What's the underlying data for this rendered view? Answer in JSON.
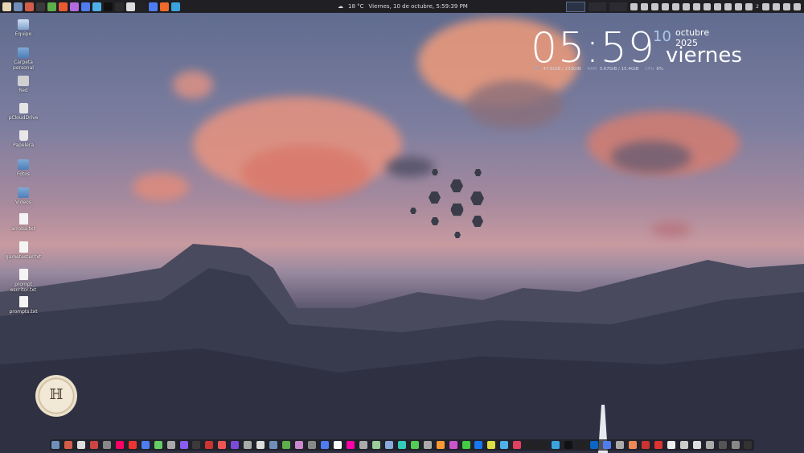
{
  "topbar": {
    "weather_icon": "cloud-rain-icon",
    "temperature": "18 °C",
    "datetime": "Viernes, 10 de octubre, 5:59:39 PM",
    "app_icons": [
      {
        "name": "avatar",
        "color": "#e8d5b5"
      },
      {
        "name": "files",
        "color": "#6f8fb8"
      },
      {
        "name": "screenshot",
        "color": "#d35d4a"
      },
      {
        "name": "terminal",
        "color": "#3a3a3a"
      },
      {
        "name": "plant",
        "color": "#5fae4d"
      },
      {
        "name": "tool",
        "color": "#e85a33"
      },
      {
        "name": "colors",
        "color": "#b36be0"
      },
      {
        "name": "ai-star",
        "color": "#4f7df0"
      },
      {
        "name": "ring",
        "color": "#4fb1e8"
      },
      {
        "name": "circle-c",
        "color": "#111111"
      },
      {
        "name": "openai",
        "color": "#2b2b2b"
      },
      {
        "name": "triangle",
        "color": "#dddddd"
      },
      {
        "name": "c-logo",
        "color": "#222222"
      },
      {
        "name": "p-app",
        "color": "#4f7df0"
      },
      {
        "name": "orange-app",
        "color": "#f06a2b"
      },
      {
        "name": "telegram",
        "color": "#3aa3dd"
      }
    ],
    "tray_count": "2"
  },
  "desktop_icons": [
    {
      "label": "Equipo",
      "kind": "monitor"
    },
    {
      "label": "Carpeta personal",
      "kind": "folder"
    },
    {
      "label": "Red",
      "kind": "drive"
    },
    {
      "label": "pCloudDrive",
      "kind": "drive"
    },
    {
      "label": "Papelera",
      "kind": "trash"
    },
    {
      "label": "Fotos",
      "kind": "folder"
    },
    {
      "label": "Videos",
      "kind": "folder"
    },
    {
      "label": "arroba.txt",
      "kind": "doc"
    },
    {
      "label": "gametester.txt",
      "kind": "doc"
    },
    {
      "label": "prompt escritor.txt",
      "kind": "doc"
    },
    {
      "label": "prompts.txt",
      "kind": "doc"
    }
  ],
  "clock": {
    "time": "05:59",
    "day": "10",
    "month_year": "octubre 2025",
    "weekday": "viernes",
    "hd_label": "HD",
    "hd_value": "47.6GiB / 233GiB",
    "ram_label": "RAM",
    "ram_value": "3.67GiB / 15.4GiB",
    "cpu_label": "CPU",
    "cpu_value": "6%"
  },
  "dock": {
    "colors": [
      "#6f8fb8",
      "#d35d4a",
      "#dddddd",
      "#c44",
      "#888",
      "#f06",
      "#e33",
      "#4f7df0",
      "#6c6",
      "#aaa",
      "#8a5cf0",
      "#3a3a3a",
      "#c33",
      "#e55",
      "#7a4ad9",
      "#aaa",
      "#ddd",
      "#6f8fb8",
      "#5fae4d",
      "#c8c",
      "#888",
      "#4f7df0",
      "#fff",
      "#f0a",
      "#aaa",
      "#9c9",
      "#8ad",
      "#3cb",
      "#5c5",
      "#aaa",
      "#f93",
      "#c5c",
      "#4c4",
      "#1877f2",
      "#dd4",
      "#4fb1e8",
      "#e4405f",
      "#222",
      "#222",
      "#3aa3dd",
      "#111",
      "#222",
      "#0a66c2",
      "#4f7df0",
      "#aaa",
      "#e85",
      "#c33",
      "#d33",
      "#eee",
      "#ccc",
      "#ddd",
      "#aaa",
      "#555",
      "#888",
      "#333"
    ]
  }
}
